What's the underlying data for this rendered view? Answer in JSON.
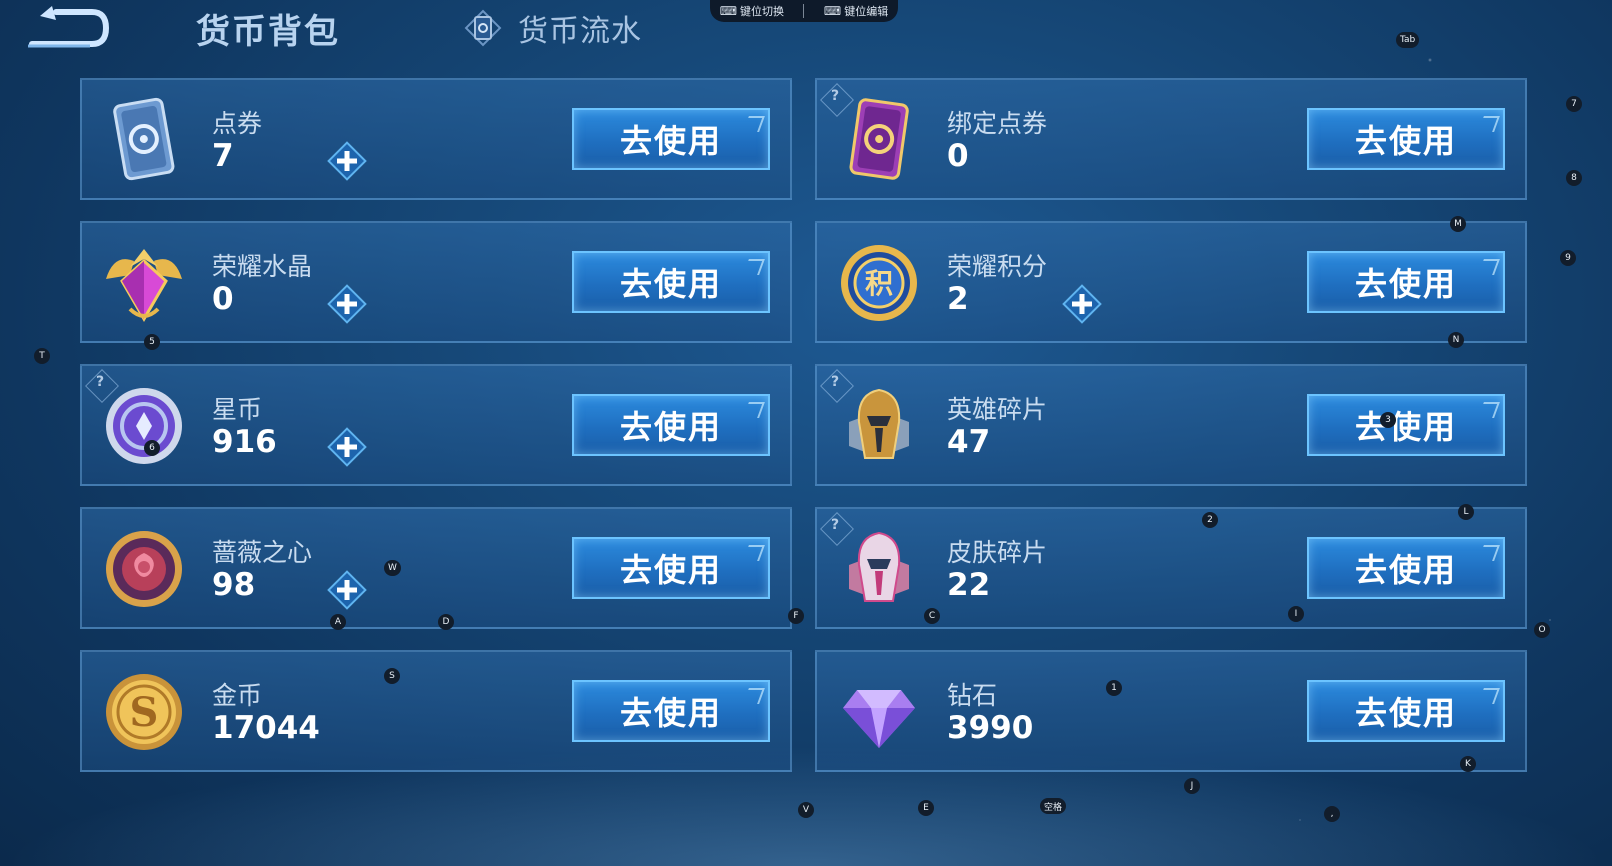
{
  "header": {
    "title": "货币背包",
    "flow_tab_label": "货币流水"
  },
  "topbar": {
    "switch_label": "键位切换",
    "edit_label": "键位编辑"
  },
  "currencies": [
    {
      "name": "点券",
      "value": "7",
      "has_plus": true,
      "help": false,
      "icon": "coupon-icon",
      "button": "去使用"
    },
    {
      "name": "绑定点券",
      "value": "0",
      "has_plus": false,
      "help": true,
      "icon": "bound-coupon-icon",
      "button": "去使用"
    },
    {
      "name": "荣耀水晶",
      "value": "0",
      "has_plus": true,
      "help": false,
      "icon": "glory-crystal-icon",
      "button": "去使用"
    },
    {
      "name": "荣耀积分",
      "value": "2",
      "has_plus": true,
      "help": false,
      "icon": "glory-points-icon",
      "button": "去使用"
    },
    {
      "name": "星币",
      "value": "916",
      "has_plus": true,
      "help": true,
      "icon": "star-coin-icon",
      "button": "去使用"
    },
    {
      "name": "英雄碎片",
      "value": "47",
      "has_plus": false,
      "help": true,
      "icon": "hero-shard-icon",
      "button": "去使用"
    },
    {
      "name": "蔷薇之心",
      "value": "98",
      "has_plus": true,
      "help": false,
      "icon": "rose-heart-icon",
      "button": "去使用"
    },
    {
      "name": "皮肤碎片",
      "value": "22",
      "has_plus": false,
      "help": true,
      "icon": "skin-shard-icon",
      "button": "去使用"
    },
    {
      "name": "金币",
      "value": "17044",
      "has_plus": false,
      "help": false,
      "icon": "gold-coin-icon",
      "button": "去使用"
    },
    {
      "name": "钻石",
      "value": "3990",
      "has_plus": false,
      "help": false,
      "icon": "diamond-icon",
      "button": "去使用"
    }
  ],
  "help_mark": "?",
  "key_hints": [
    "Tab",
    "7",
    "8",
    "M",
    "9",
    "N",
    "T",
    "5",
    "3",
    "6",
    "2",
    "L",
    "W",
    "A",
    "D",
    "F",
    "C",
    "I",
    "O",
    "S",
    "1",
    "K",
    "J",
    "V",
    "E",
    "空格",
    ","
  ]
}
